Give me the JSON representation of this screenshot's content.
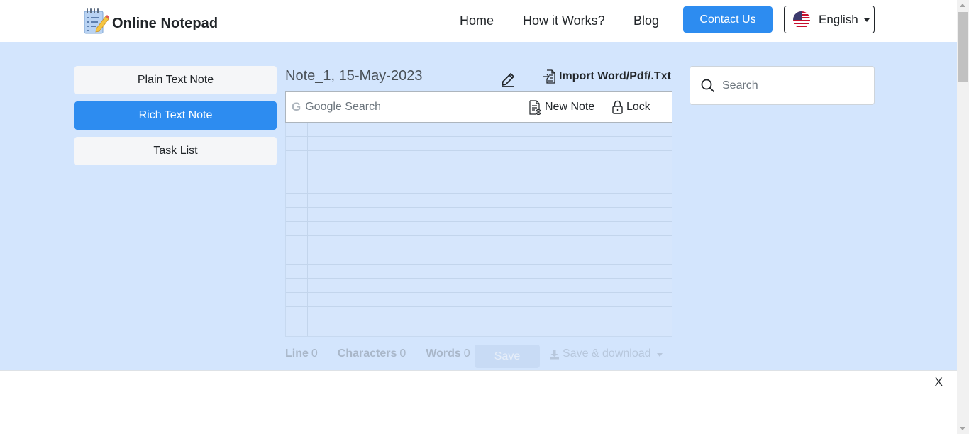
{
  "brand": {
    "name": "Online Notepad"
  },
  "nav": {
    "home": "Home",
    "how": "How it Works?",
    "blog": "Blog",
    "contact": "Contact Us",
    "language": "English"
  },
  "menu": {
    "plain": "Plain Text Note",
    "rich": "Rich Text Note",
    "tasks": "Task List"
  },
  "note": {
    "title": "Note_1, 15-May-2023",
    "import": "Import Word/Pdf/.Txt",
    "google_placeholder": "Google Search",
    "new_note": "New Note",
    "lock": "Lock"
  },
  "stats": {
    "line_label": "Line",
    "line": "0",
    "chars_label": "Characters",
    "chars": "0",
    "words_label": "Words",
    "words": "0"
  },
  "actions": {
    "save": "Save",
    "download": "Save & download"
  },
  "search": {
    "placeholder": "Search"
  },
  "ad": {
    "close": "X"
  },
  "colors": {
    "accent": "#2d8cf0",
    "background": "#d3e5fd"
  },
  "icons": [
    "notepad-logo",
    "us-flag-icon",
    "pencil-icon",
    "import-file-icon",
    "google-icon",
    "new-note-icon",
    "lock-icon",
    "download-icon",
    "search-icon"
  ]
}
